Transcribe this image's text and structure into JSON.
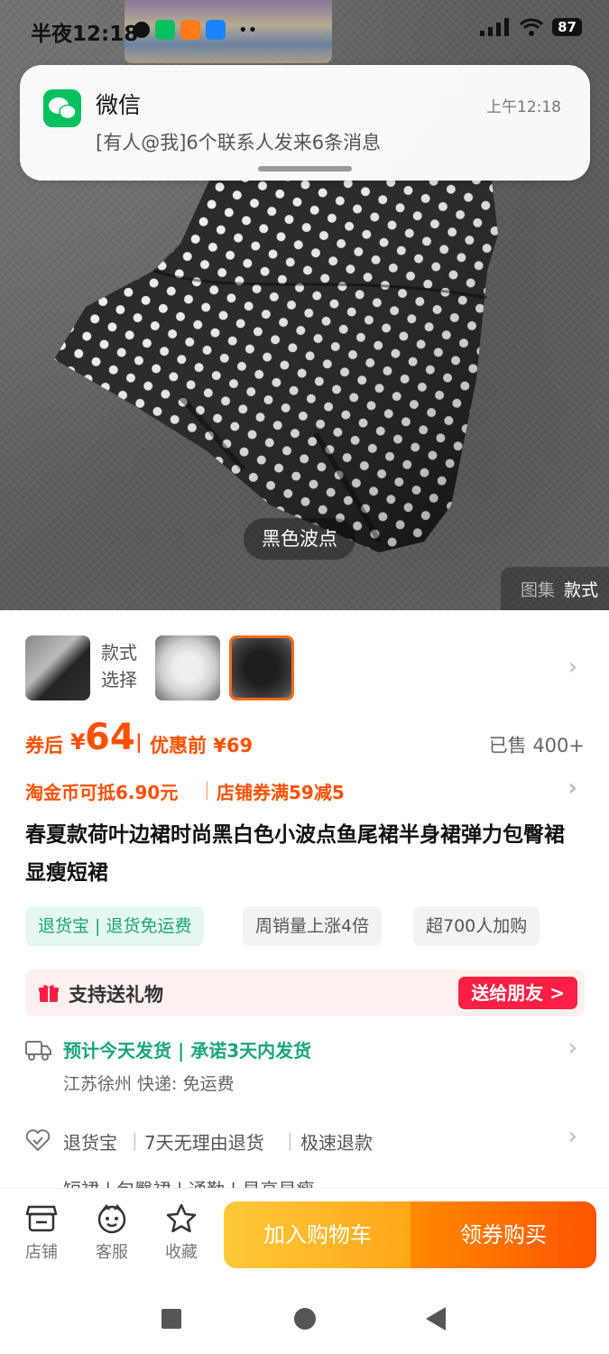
{
  "status_bar": {
    "time": "半夜12:18",
    "battery": "87",
    "app_icons": [
      "alarm-icon",
      "wechat-icon",
      "xiaohongshu-icon",
      "appstore-icon"
    ]
  },
  "notification": {
    "app_name": "微信",
    "time": "上午12:18",
    "message": "[有人@我]6个联系人发来6条消息"
  },
  "hero": {
    "variant_caption": "黑色波点",
    "tabs": {
      "gallery": "图集",
      "style": "款式"
    }
  },
  "variants": {
    "label": "款式选择",
    "selected_index": 2,
    "count": 3
  },
  "price": {
    "coupon_label": "券后",
    "currency": "¥",
    "after_coupon": "64",
    "separator": "|",
    "before_label": "优惠前 ¥69",
    "sold": "已售 400+"
  },
  "promo": {
    "coin": "淘金币可抵6.90元",
    "separator": "|",
    "shop_coupon": "店铺券满59减5"
  },
  "title": "春夏款荷叶边裙时尚黑白色小波点鱼尾裙半身裙弹力包臀裙显瘦短裙",
  "tags": [
    "退货宝 | 退货免运费",
    "周销量上涨4倍",
    "超700人加购"
  ],
  "gift": {
    "text": "支持送礼物",
    "button": "送给朋友 >"
  },
  "shipping": {
    "main": "预计今天发货 | 承诺3天内发货",
    "sub": "江苏徐州  快递: 免运费"
  },
  "services": [
    "退货宝",
    "7天无理由退货",
    "极速退款"
  ],
  "services_row2": "短裙  |  包臀裙  |  通勤  |  显高显瘦",
  "bottom_bar": {
    "shop": "店铺",
    "service": "客服",
    "favorite": "收藏",
    "add_to_cart": "加入购物车",
    "buy": "领券购买"
  },
  "colors": {
    "accent_orange": "#ff5000",
    "green": "#1aa57a",
    "gift_red": "#ff1e44",
    "wechat_green": "#07c160"
  }
}
